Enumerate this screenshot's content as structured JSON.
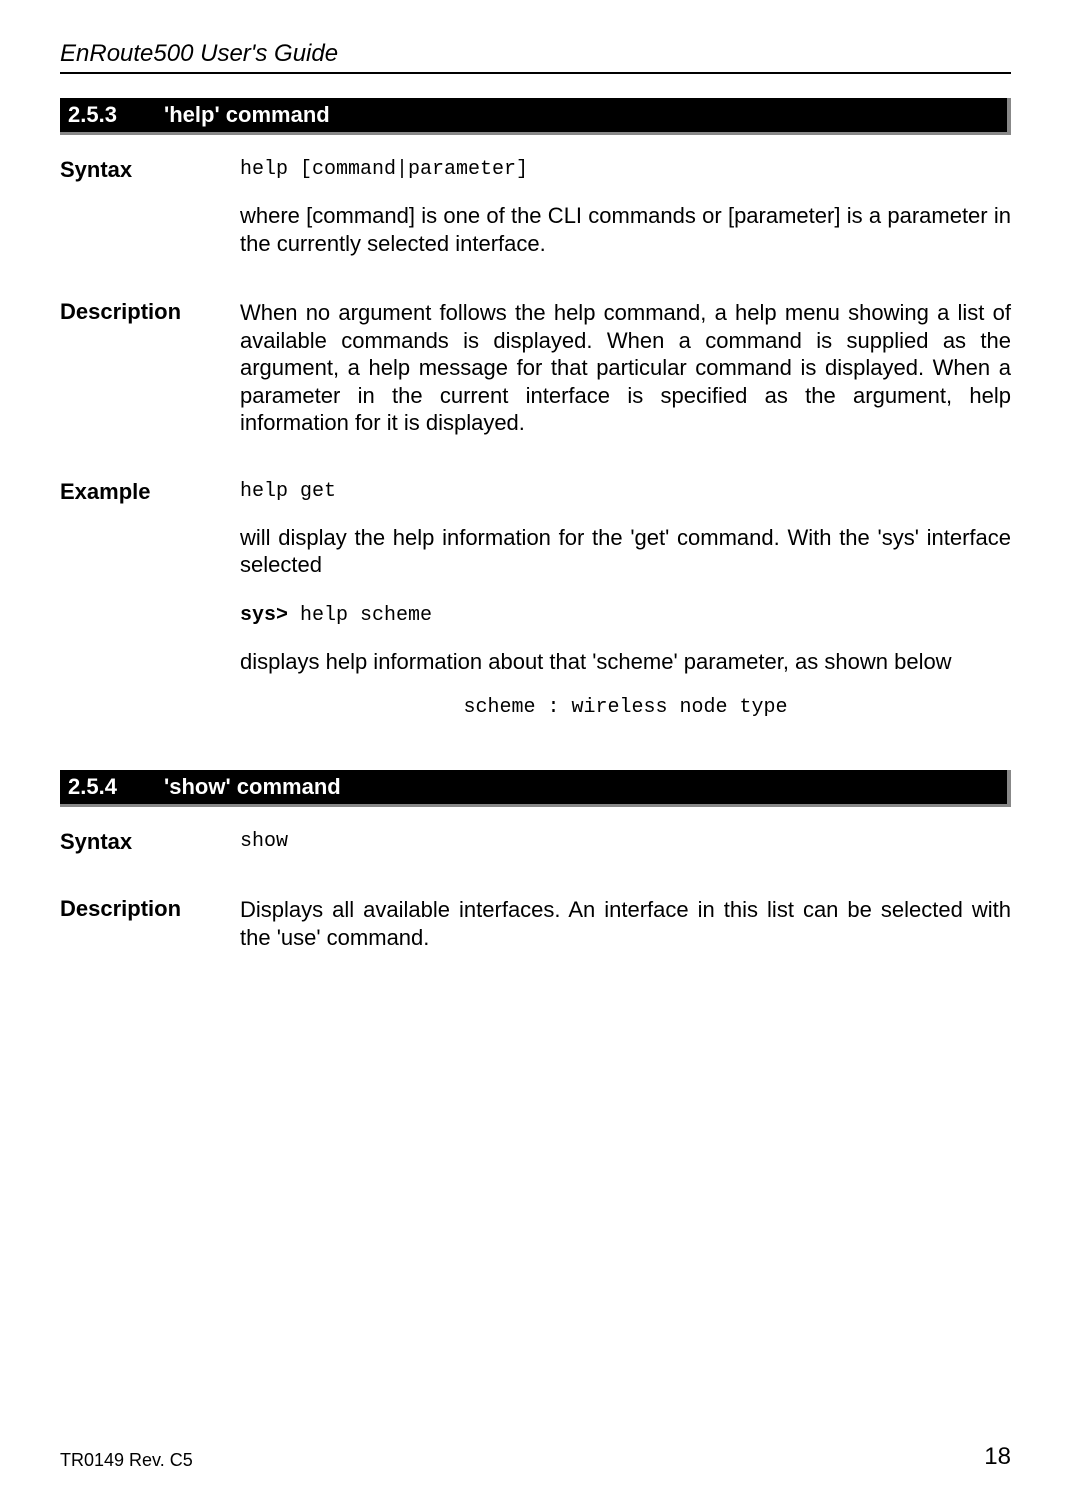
{
  "header": {
    "title": "EnRoute500 User's Guide"
  },
  "sections": [
    {
      "num": "2.5.3",
      "title": "'help' command",
      "rows": [
        {
          "label": "Syntax",
          "blocks": [
            {
              "kind": "mono",
              "text": "help [command|parameter]"
            },
            {
              "kind": "text",
              "text": "where [command] is one of the CLI commands or [parameter] is a parameter in the currently selected interface."
            }
          ]
        },
        {
          "label": "Description",
          "blocks": [
            {
              "kind": "text",
              "text": "When no argument follows the help command, a help menu showing a list of available commands is displayed. When a command is supplied as the argument, a help message for that particular command is displayed. When a parameter in the current interface is specified as the argument, help information for it is displayed."
            }
          ]
        },
        {
          "label": "Example",
          "blocks": [
            {
              "kind": "mono",
              "text": "help get"
            },
            {
              "kind": "text",
              "text": "will display the help information for the 'get' command. With the 'sys' interface selected"
            },
            {
              "kind": "prompt",
              "prompt": "sys>",
              "cmd": " help scheme"
            },
            {
              "kind": "text",
              "text": "displays help information about that 'scheme' parameter, as shown below"
            },
            {
              "kind": "center-mono",
              "text": "scheme : wireless node type"
            }
          ]
        }
      ]
    },
    {
      "num": "2.5.4",
      "title": "'show' command",
      "rows": [
        {
          "label": "Syntax",
          "blocks": [
            {
              "kind": "mono",
              "text": "show"
            }
          ]
        },
        {
          "label": "Description",
          "blocks": [
            {
              "kind": "text",
              "text": "Displays all available interfaces. An interface in this list can be selected with the 'use' command."
            }
          ]
        }
      ]
    }
  ],
  "footer": {
    "left": "TR0149 Rev. C5",
    "right": "18"
  }
}
